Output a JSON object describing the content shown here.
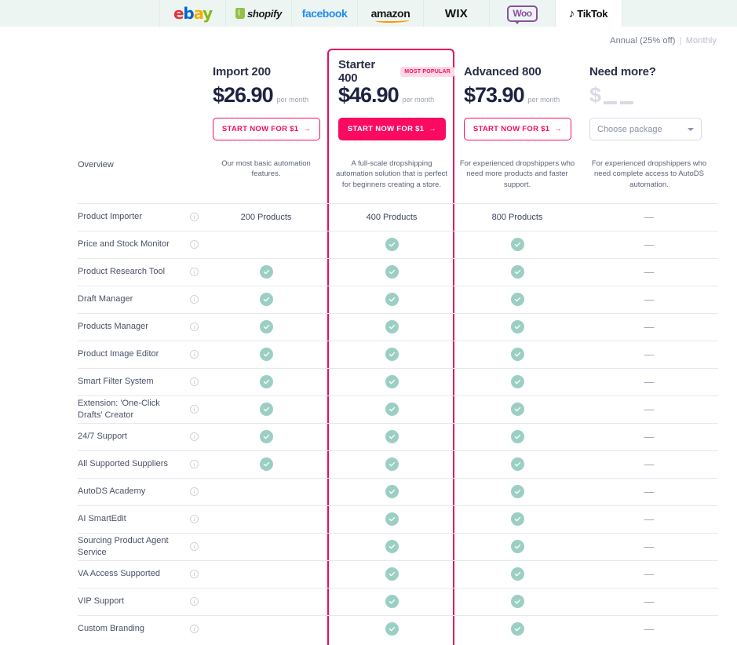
{
  "tabs": [
    {
      "name": "ebay",
      "label": "ebay",
      "active": false
    },
    {
      "name": "shopify",
      "label": "shopify",
      "active": false
    },
    {
      "name": "facebook",
      "label": "facebook",
      "active": false
    },
    {
      "name": "amazon",
      "label": "amazon",
      "active": false
    },
    {
      "name": "wix",
      "label": "WIX",
      "active": false
    },
    {
      "name": "woocommerce",
      "label": "Woo",
      "active": false
    },
    {
      "name": "tiktok",
      "label": "TikTok",
      "active": true
    }
  ],
  "billing": {
    "annual_label": "Annual (25% off)",
    "separator": "|",
    "monthly_label": "Monthly",
    "selected": "Annual (25% off)"
  },
  "colors": {
    "accent_pink": "#fa0a60",
    "badge_bg": "#ffd9e6",
    "check_green": "#9ccfc4",
    "tabbar_bg": "#edf5f2",
    "price_navy": "#1f2240"
  },
  "plans": [
    {
      "name": "Import 200",
      "badge": "",
      "price": "$26.90",
      "price_unit": "per month",
      "cta_label": "START NOW FOR $1",
      "cta_style": "outline",
      "overview": "Our most basic automation features."
    },
    {
      "name": "Starter 400",
      "badge": "MOST POPULAR",
      "price": "$46.90",
      "price_unit": "per month",
      "cta_label": "START NOW FOR $1",
      "cta_style": "solid",
      "overview": "A full-scale dropshipping automation solution that is perfect for beginners creating a store."
    },
    {
      "name": "Advanced 800",
      "badge": "",
      "price": "$73.90",
      "price_unit": "per month",
      "cta_label": "START NOW FOR $1",
      "cta_style": "outline",
      "overview": "For experienced dropshippers who need more products and faster support."
    },
    {
      "name": "Need more?",
      "badge": "",
      "price": "$",
      "price_unit": "",
      "cta_label": "Choose package",
      "cta_style": "select",
      "overview": "For experienced dropshippers who need complete access to AutoDS automation."
    }
  ],
  "table": {
    "overview_row_label": "Overview",
    "rows": [
      {
        "label": "Product Importer",
        "values": [
          "200 Products",
          "400 Products",
          "800 Products",
          "dash"
        ]
      },
      {
        "label": "Price and Stock Monitor",
        "values": [
          "none",
          "check",
          "check",
          "dash"
        ]
      },
      {
        "label": "Product Research Tool",
        "values": [
          "check",
          "check",
          "check",
          "dash"
        ]
      },
      {
        "label": "Draft Manager",
        "values": [
          "check",
          "check",
          "check",
          "dash"
        ]
      },
      {
        "label": "Products Manager",
        "values": [
          "check",
          "check",
          "check",
          "dash"
        ]
      },
      {
        "label": "Product Image Editor",
        "values": [
          "check",
          "check",
          "check",
          "dash"
        ]
      },
      {
        "label": "Smart Filter System",
        "values": [
          "check",
          "check",
          "check",
          "dash"
        ]
      },
      {
        "label": "Extension: 'One-Click Drafts' Creator",
        "values": [
          "check",
          "check",
          "check",
          "dash"
        ]
      },
      {
        "label": "24/7 Support",
        "values": [
          "check",
          "check",
          "check",
          "dash"
        ]
      },
      {
        "label": "All Supported Suppliers",
        "values": [
          "check",
          "check",
          "check",
          "dash"
        ]
      },
      {
        "label": "AutoDS Academy",
        "values": [
          "none",
          "check",
          "check",
          "dash"
        ]
      },
      {
        "label": "AI SmartEdit",
        "values": [
          "none",
          "check",
          "check",
          "dash"
        ]
      },
      {
        "label": "Sourcing Product Agent Service",
        "values": [
          "none",
          "check",
          "check",
          "dash"
        ]
      },
      {
        "label": "VA Access Supported",
        "values": [
          "none",
          "check",
          "check",
          "dash"
        ]
      },
      {
        "label": "VIP Support",
        "values": [
          "none",
          "check",
          "check",
          "dash"
        ]
      },
      {
        "label": "Custom Branding",
        "values": [
          "none",
          "check",
          "check",
          "dash"
        ]
      }
    ]
  }
}
